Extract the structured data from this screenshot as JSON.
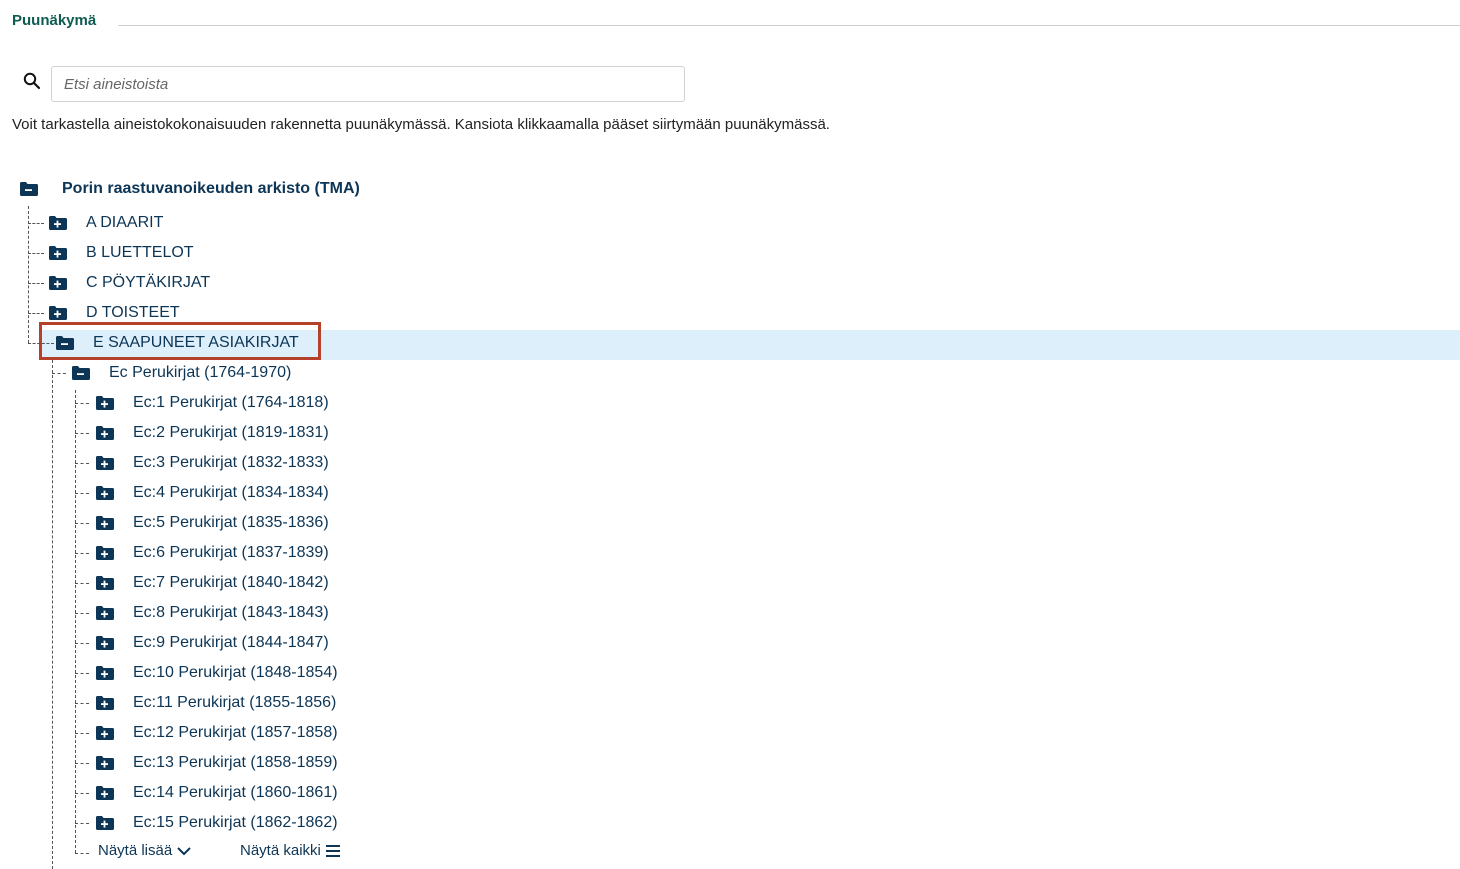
{
  "section": {
    "title": "Puunäkymä"
  },
  "search": {
    "placeholder": "Etsi aineistoista"
  },
  "description": "Voit tarkastella aineistokokonaisuuden rakennetta puunäkymässä. Kansiota klikkaamalla pääset siirtymään puunäkymässä.",
  "tree": {
    "root": {
      "label": "Porin raastuvanoikeuden arkisto (TMA)",
      "icon": "folder-minus-icon"
    },
    "level1": [
      {
        "label": "A DIAARIT",
        "icon": "folder-plus-icon"
      },
      {
        "label": "B LUETTELOT",
        "icon": "folder-plus-icon"
      },
      {
        "label": "C PÖYTÄKIRJAT",
        "icon": "folder-plus-icon"
      },
      {
        "label": "D TOISTEET",
        "icon": "folder-plus-icon"
      },
      {
        "label": "E SAAPUNEET ASIAKIRJAT",
        "icon": "folder-minus-icon",
        "selected": true
      }
    ],
    "level2": {
      "label": "Ec Perukirjat (1764-1970)",
      "icon": "folder-minus-icon"
    },
    "level3": [
      "Ec:1 Perukirjat (1764-1818)",
      "Ec:2 Perukirjat (1819-1831)",
      "Ec:3 Perukirjat (1832-1833)",
      "Ec:4 Perukirjat (1834-1834)",
      "Ec:5 Perukirjat (1835-1836)",
      "Ec:6 Perukirjat (1837-1839)",
      "Ec:7 Perukirjat (1840-1842)",
      "Ec:8 Perukirjat (1843-1843)",
      "Ec:9 Perukirjat (1844-1847)",
      "Ec:10 Perukirjat (1848-1854)",
      "Ec:11 Perukirjat (1855-1856)",
      "Ec:12 Perukirjat (1857-1858)",
      "Ec:13 Perukirjat (1858-1859)",
      "Ec:14 Perukirjat (1860-1861)",
      "Ec:15 Perukirjat (1862-1862)"
    ],
    "show_more": "Näytä lisää",
    "show_all": "Näytä kaikki"
  },
  "colors": {
    "title": "#0e5b52",
    "link": "#0d3555",
    "selected_bg": "#dceffa",
    "selection_outline": "#b5412a"
  }
}
